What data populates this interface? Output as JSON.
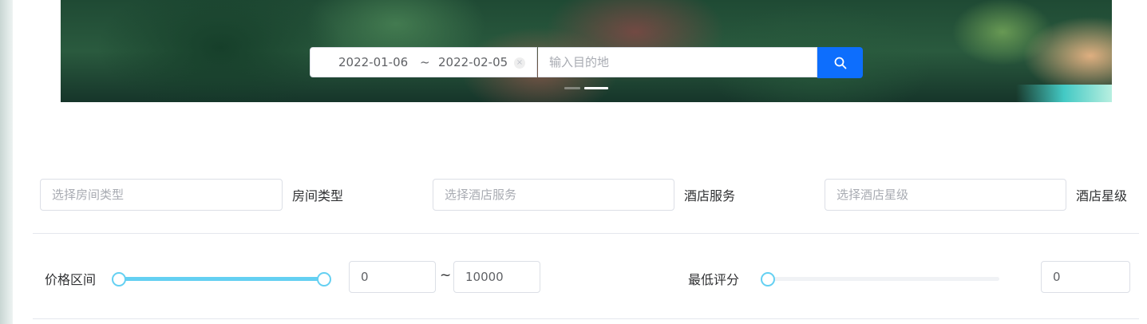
{
  "search": {
    "date_start": "2022-01-06",
    "date_separator": "~",
    "date_end": "2022-02-05",
    "destination_placeholder": "输入目的地",
    "search_icon": "search-icon"
  },
  "carousel": {
    "indicator_count": 2,
    "active_index": 1
  },
  "filters": {
    "room_type": {
      "placeholder": "选择房间类型",
      "label": "房间类型"
    },
    "hotel_service": {
      "placeholder": "选择酒店服务",
      "label": "酒店服务"
    },
    "hotel_star": {
      "placeholder": "选择酒店星级",
      "label": "酒店星级"
    }
  },
  "price": {
    "label": "价格区间",
    "min": "0",
    "separator": "~",
    "max": "10000",
    "slider_min_fraction": 0,
    "slider_max_fraction": 1
  },
  "rating": {
    "label": "最低评分",
    "value": "0",
    "slider_fraction": 0
  },
  "colors": {
    "primary": "#0d6efd",
    "slider": "#64d0f2",
    "border": "#dcdfe6"
  }
}
